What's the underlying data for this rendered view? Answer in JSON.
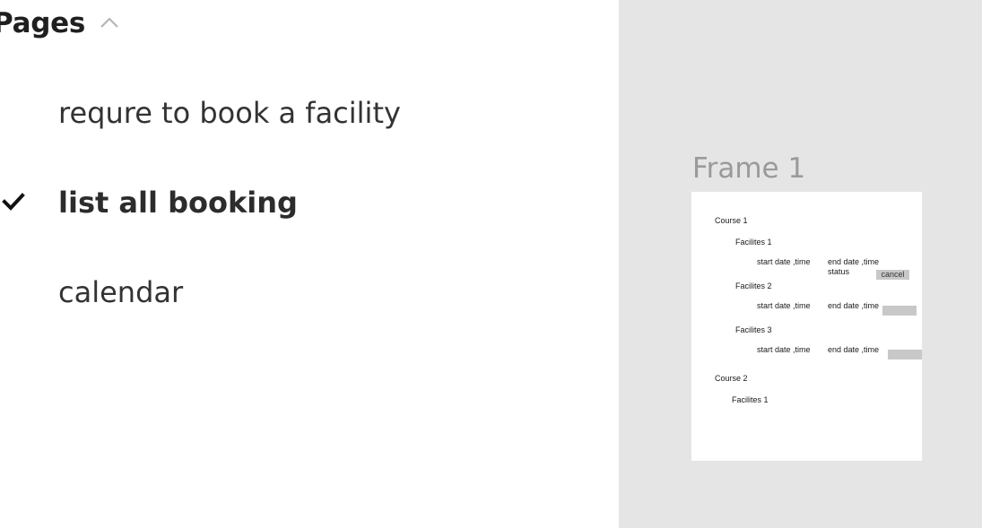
{
  "pages_panel": {
    "title": "Pages",
    "items": [
      {
        "label": "requre to book a facility",
        "selected": false
      },
      {
        "label": "list all booking",
        "selected": true
      },
      {
        "label": "calendar",
        "selected": false
      }
    ]
  },
  "canvas": {
    "background": "#e5e5e5",
    "frame": {
      "title": "Frame 1",
      "courses": [
        {
          "name": "Course 1",
          "facilities": [
            {
              "name": "Facilites 1",
              "start": "start date ,time",
              "end": "end date ,time",
              "status": "status",
              "action": "cancel"
            },
            {
              "name": "Facilites 2",
              "start": "start date ,time",
              "end": "end date ,time"
            },
            {
              "name": "Facilites 3",
              "start": "start date ,time",
              "end": "end date ,time"
            }
          ]
        },
        {
          "name": "Course 2",
          "facilities": [
            {
              "name": "Facilites 1"
            }
          ]
        }
      ]
    }
  }
}
